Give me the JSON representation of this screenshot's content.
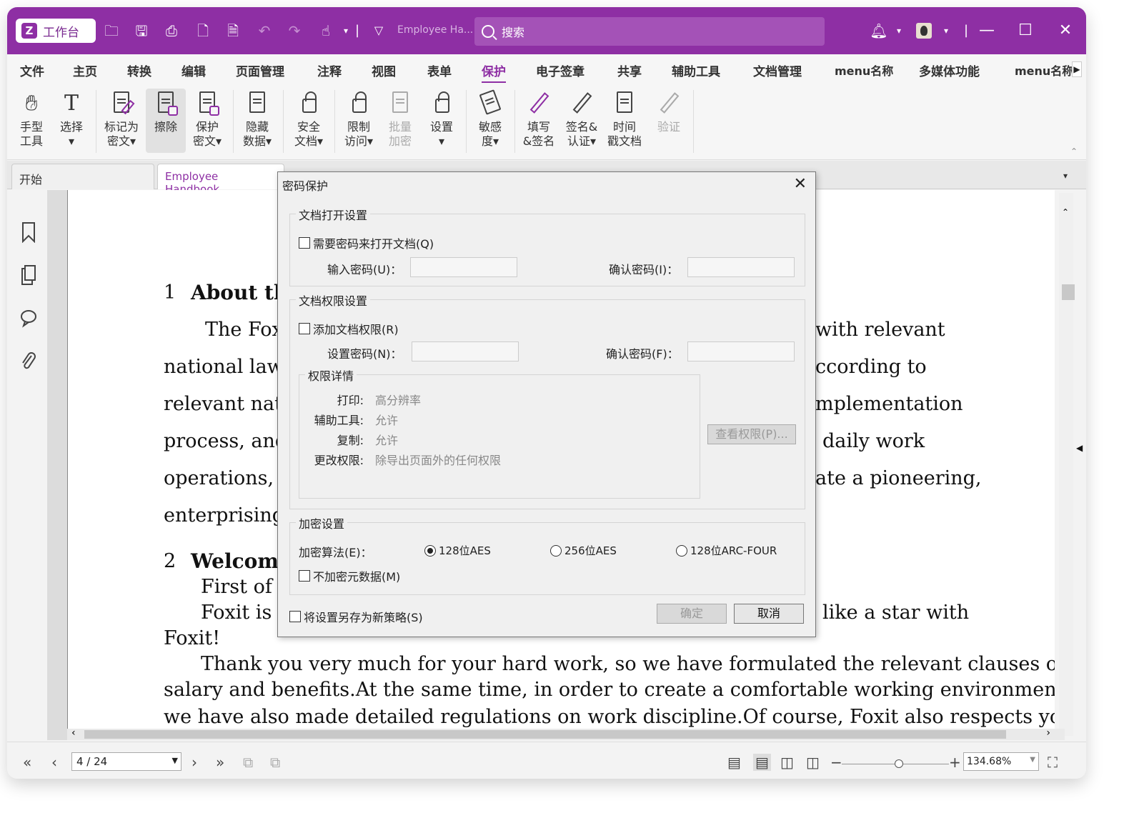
{
  "titlebar": {
    "workbench_label": "工作台",
    "doc_title": "Employee Ha...",
    "search_placeholder": "搜索",
    "colors": {
      "accent": "#8e2fa4"
    }
  },
  "menu": {
    "items": [
      "文件",
      "主页",
      "转换",
      "编辑",
      "页面管理",
      "注释",
      "视图",
      "表单",
      "保护",
      "电子签章",
      "共享",
      "辅助工具",
      "文档管理",
      "menu名称",
      "多媒体功能",
      "menu名称"
    ],
    "active": "保护"
  },
  "ribbon": {
    "hand_tool": [
      "手型",
      "工具"
    ],
    "select": [
      "选择",
      "▾"
    ],
    "mark_redact": [
      "标记为",
      "密文▾"
    ],
    "erase": [
      "擦除"
    ],
    "protect_redact": [
      "保护",
      "密文▾"
    ],
    "hide_data": [
      "隐藏",
      "数据▾"
    ],
    "secure_doc": [
      "安全",
      "文档▾"
    ],
    "restrict_access": [
      "限制",
      "访问▾"
    ],
    "batch_encrypt": [
      "批量",
      "加密"
    ],
    "settings": [
      "设置",
      "▾"
    ],
    "sensitivity": [
      "敏感",
      "度▾"
    ],
    "fill_sign": [
      "填写",
      "&签名"
    ],
    "sign_cert": [
      "签名&",
      "认证▾"
    ],
    "timestamp": [
      "时间",
      "戳文档"
    ],
    "verify": [
      "验证"
    ]
  },
  "tabs": {
    "start": "开始",
    "document": "Employee Handbook...."
  },
  "document": {
    "heading1_num": "1",
    "heading1": "About the",
    "p1_left": "The Fox",
    "p1_right": "with relevant",
    "p2_left": "national laws",
    "p2_right": "ccording to",
    "p3_left": "relevant nati",
    "p3_right": "mplementation",
    "p4_left": "process, and",
    "p4_right": "daily work",
    "p5_left": "operations, c",
    "p5_right": "ate a pioneering,",
    "p6_left": "enterprising,",
    "heading2_num": "2",
    "heading2": "Welcome",
    "p7_left": "First of a",
    "p8_left": "Foxit is e",
    "p8_right": "like a star with",
    "p9": "Foxit!",
    "p10": "Thank you very much for your hard work, so we have formulated the relevant clauses of",
    "p11": "salary and benefits.At the same time, in order to create a comfortable working environment,",
    "p12": "we have also made detailed regulations on work discipline.Of course, Foxit also respects your"
  },
  "statusbar": {
    "page": "4 / 24",
    "zoom": "134.68%"
  },
  "dialog": {
    "title": "密码保护",
    "open_group": "文档打开设置",
    "require_password": "需要密码来打开文档(Q)",
    "enter_password": "输入密码(U)：",
    "confirm_password_i": "确认密码(I)：",
    "perm_group": "文档权限设置",
    "add_permissions": "添加文档权限(R)",
    "set_password": "设置密码(N)：",
    "confirm_password_f": "确认密码(F)：",
    "perm_details": "权限详情",
    "perms": [
      {
        "key": "打印:",
        "value": "高分辨率"
      },
      {
        "key": "辅助工具:",
        "value": "允许"
      },
      {
        "key": "复制:",
        "value": "允许"
      },
      {
        "key": "更改权限:",
        "value": "除导出页面外的任何权限"
      }
    ],
    "view_perms_button": "查看权限(P)...",
    "enc_group": "加密设置",
    "enc_algorithm": "加密算法(E)：",
    "algo_options": [
      "128位AES",
      "256位AES",
      "128位ARC-FOUR"
    ],
    "algo_selected": "128位AES",
    "no_encrypt_meta": "不加密元数据(M)",
    "save_policy": "将设置另存为新策略(S)",
    "ok": "确定",
    "cancel": "取消"
  }
}
